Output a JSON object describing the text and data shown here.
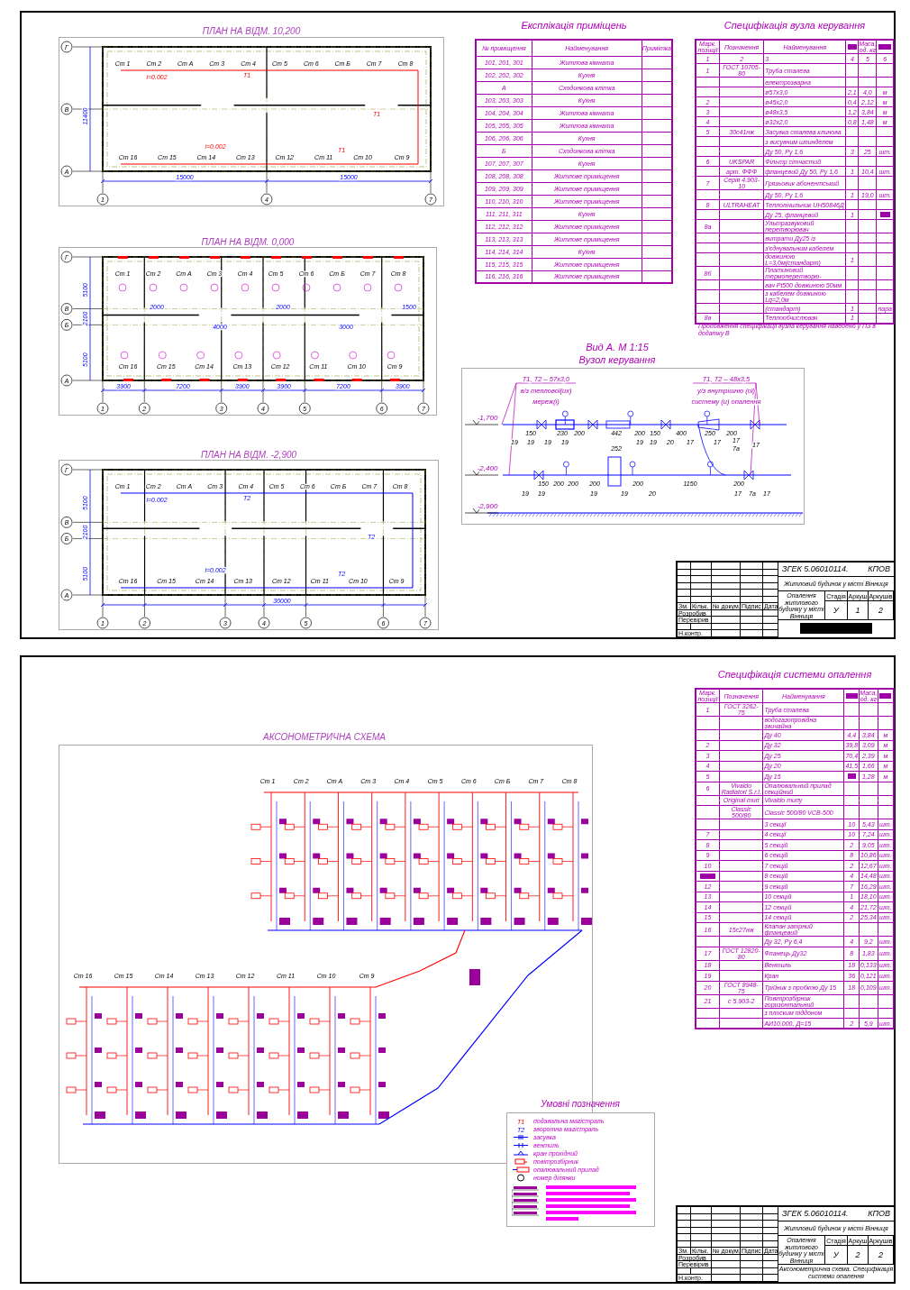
{
  "sheet_1": {
    "plans": [
      {
        "title": "ПЛАН НА ВІДМ. 10,200",
        "kind": "supply",
        "rows": [
          "Г",
          "В",
          "А"
        ],
        "cols": [
          "1",
          "4",
          "7"
        ],
        "dims": [
          "15000",
          "15000"
        ],
        "side_dims": [
          "11400"
        ],
        "top_risers": [
          "Ст 1",
          "Ст 2",
          "Ст А",
          "Ст 3",
          "Ст 4",
          "Ст 5",
          "Ст 6",
          "Ст Б",
          "Ст 7",
          "Ст 8"
        ],
        "bottom_risers": [
          "Ст 16",
          "Ст 15",
          "Ст 14",
          "Ст 13",
          "Ст 12",
          "Ст 11",
          "Ст 10",
          "Ст 9"
        ],
        "slopes": [
          "i=0.002",
          "i=0.002"
        ],
        "line_labels": [
          "Т1",
          "Т1",
          "Т1"
        ]
      },
      {
        "title": "ПЛАН НА ВІДМ. 0,000",
        "kind": "radiators",
        "rows": [
          "Г",
          "В",
          "Б",
          "А"
        ],
        "cols": [
          "1",
          "2",
          "3",
          "4",
          "5",
          "6",
          "7"
        ],
        "dims": [
          "3900",
          "7200",
          "3900",
          "3900",
          "7200",
          "3900"
        ],
        "side_dims": [
          "5100",
          "2100",
          "5100"
        ],
        "top_risers": [
          "Ст 1",
          "Ст 2",
          "Ст А",
          "Ст 3",
          "Ст 4",
          "Ст 5",
          "Ст 6",
          "Ст Б",
          "Ст 7",
          "Ст 8"
        ],
        "bottom_risers": [
          "Ст 16",
          "Ст 15",
          "Ст 14",
          "Ст 13",
          "Ст 12",
          "Ст 11",
          "Ст 10",
          "Ст 9"
        ],
        "inner_dims": [
          "2000",
          "4000",
          "2000",
          "3000",
          "1500"
        ]
      },
      {
        "title": "ПЛАН НА ВІДМ. -2,900",
        "kind": "return",
        "rows": [
          "Г",
          "В",
          "Б",
          "А"
        ],
        "cols": [
          "1",
          "2",
          "3",
          "4",
          "5",
          "6",
          "7"
        ],
        "dims": [
          "30000"
        ],
        "side_dims": [
          "5100",
          "2100",
          "5100"
        ],
        "top_risers": [
          "Ст 1",
          "Ст 2",
          "Ст А",
          "Ст 3",
          "Ст 4",
          "Ст 5",
          "Ст 6",
          "Ст Б",
          "Ст 7",
          "Ст 8"
        ],
        "bottom_risers": [
          "Ст 16",
          "Ст 15",
          "Ст 14",
          "Ст 13",
          "Ст 12",
          "Ст 11",
          "Ст 10",
          "Ст 9"
        ],
        "slopes": [
          "i=0.002",
          "i=0.002"
        ],
        "line_labels": [
          "Т2",
          "Т2",
          "Т2"
        ]
      }
    ],
    "explication": {
      "title": "Експлікація приміщень",
      "columns": [
        "№ приміщення",
        "Найменування",
        "Примітка"
      ],
      "rows": [
        [
          "101, 201, 301",
          "Житлова кімната",
          ""
        ],
        [
          "102, 202, 302",
          "Кухня",
          ""
        ],
        [
          "А",
          "Сходинкова клітка",
          ""
        ],
        [
          "103, 203, 303",
          "Кухня",
          ""
        ],
        [
          "104, 204, 304",
          "Житлова кімната",
          ""
        ],
        [
          "105, 205, 305",
          "Житлова кімната",
          ""
        ],
        [
          "106, 206, 306",
          "Кухня",
          ""
        ],
        [
          "Б",
          "Сходинкова клітка",
          ""
        ],
        [
          "107, 207, 307",
          "Кухня",
          ""
        ],
        [
          "108, 208, 308",
          "Житлове приміщення",
          ""
        ],
        [
          "109, 209, 309",
          "Житлове приміщення",
          ""
        ],
        [
          "110, 210, 310",
          "Житлове приміщення",
          ""
        ],
        [
          "111, 211, 311",
          "Кухня",
          ""
        ],
        [
          "112, 212, 312",
          "Житлове приміщення",
          ""
        ],
        [
          "113, 213, 313",
          "Житлове приміщення",
          ""
        ],
        [
          "114, 214, 314",
          "Кухня",
          ""
        ],
        [
          "115, 215, 315",
          "Житлове приміщення",
          ""
        ],
        [
          "116, 216, 316",
          "Житлове приміщення",
          ""
        ]
      ]
    },
    "spec": {
      "title": "Специфікація вузла керування",
      "columns": [
        "Марк. позиції",
        "Позначення",
        "Найменування",
        {
          "kind": "blot"
        },
        "Маса, од. кг",
        {
          "kind": "blot"
        }
      ],
      "rows": [
        [
          "1",
          "2",
          "3",
          "4",
          "5",
          "6"
        ],
        [
          "1",
          "ГОСТ 10705-80",
          "Труба сталева",
          "",
          "",
          ""
        ],
        [
          "",
          "",
          "електрозварна",
          "",
          "",
          ""
        ],
        [
          "",
          "",
          "ø57х3,0",
          "2,1",
          "4,0",
          "м"
        ],
        [
          "2",
          "",
          "ø45х2,0",
          "0,4",
          "2,12",
          "м"
        ],
        [
          "3",
          "",
          "ø48х3,5",
          "1,2",
          "3,84",
          "м"
        ],
        [
          "4",
          "",
          "ø32х2,0",
          "0,8",
          "1,48",
          "м"
        ],
        [
          "5",
          "30с41нж",
          "Засувка сталева клинова",
          "",
          "",
          ""
        ],
        [
          "",
          "",
          "з висувним шпинделем",
          "",
          "",
          ""
        ],
        [
          "",
          "",
          "Ду 50, Ру 1,6",
          "3",
          "25",
          "шт."
        ],
        [
          "6",
          "UKSPAR",
          "Фільтр сітчастий",
          "",
          "",
          ""
        ],
        [
          "",
          "арт. ФФФ",
          "фланцевий Ду 50, Ру 1,6",
          "1",
          "10,4",
          "шт."
        ],
        [
          "7",
          "Серія 4.903-10",
          "Грязьовик абонентський",
          "",
          "",
          ""
        ],
        [
          "",
          "",
          "Ду 50, Ру 1,6",
          "1",
          "19,0",
          "шт."
        ],
        [
          "8",
          "ULTRAHEAT",
          "Теплолічильник UH50846Д",
          "",
          "",
          ""
        ],
        [
          "",
          "",
          "Ду 25, фланцевий",
          "1",
          "",
          {
            "kind": "blot"
          }
        ],
        [
          "8а",
          "",
          "Ультразвуковий перетворювач",
          "",
          "",
          ""
        ],
        [
          "",
          "",
          "витрати Ду25 із",
          "",
          "",
          ""
        ],
        [
          "",
          "",
          "з'єднувальним кабелем",
          "",
          "",
          ""
        ],
        [
          "",
          "",
          "довжиною L=3,0м(стандарт)",
          "1",
          "",
          ""
        ],
        [
          "8б",
          "",
          "Платиновий термоперетворю-",
          "",
          "",
          ""
        ],
        [
          "",
          "",
          "вач Pt500 довжиною 50мм",
          "",
          "",
          ""
        ],
        [
          "",
          "",
          "з кабелем довжиною Lg=2,0м",
          "",
          "",
          ""
        ],
        [
          "",
          "",
          "(стандарт)",
          "1",
          "",
          "пара"
        ],
        [
          "8в",
          "",
          "Теплообчислювач",
          "1",
          "",
          ""
        ]
      ],
      "note": "Продовження специфікації вузла керування наведено у ПЗ в додатку В"
    },
    "valve_unit": {
      "title": "Вид А. М 1:15",
      "subtitle": "Вузол керування",
      "inlet": {
        "pipe": "Т1, Т2 – 57х3,0",
        "lines": [
          "в/з теплової(их)",
          "мереж(і)"
        ]
      },
      "outlet": {
        "pipe": "Т1, Т2 – 48х3,5",
        "lines": [
          "у/з внутрішню (ої)",
          "систему (и) опалення"
        ]
      },
      "levels": [
        "-1,700",
        "-2,400",
        "-2,900"
      ],
      "top_dims": [
        "150",
        "230",
        "200",
        "442",
        "200",
        "150",
        "400",
        "250",
        "200"
      ],
      "bottom_dims": [
        "150",
        "200",
        "200",
        "200",
        "252",
        "200",
        "1150",
        "200"
      ],
      "top_callouts": [
        "19",
        "19",
        "19",
        "19",
        "19",
        "19",
        "20",
        "17",
        "17",
        "17",
        "7а",
        "17"
      ],
      "bottom_callouts": [
        "19",
        "19",
        "19",
        "19",
        "20",
        "17",
        "7а",
        "17"
      ]
    },
    "title_block": {
      "code": "ЗГЕК 5.06010114.",
      "suffix": "КПОВ",
      "project": "Житловий будинок у місті Вінниця",
      "sheet_title": "Опалення житлового будинку у місті Вінниця",
      "col_headers": [
        "Зм.",
        "Кільк.",
        "№ докум.",
        "Підпис",
        "Дата"
      ],
      "roles": [
        "Розробив",
        "Перевірив",
        "Н.контр."
      ],
      "stage_headers": [
        "Стадія",
        "Аркуш",
        "Аркушів"
      ],
      "stage_values": [
        "У",
        "1",
        "2"
      ],
      "redacted": true
    }
  },
  "sheet_2": {
    "spec": {
      "title": "Специфікація системи опалення",
      "columns": [
        "Марк. позиції",
        "Позначення",
        "Найменування",
        {
          "kind": "blot"
        },
        "Маса, од. кг",
        {
          "kind": "blot"
        }
      ],
      "rows": [
        [
          "1",
          "ГОСТ 3262-75",
          "Труба сталева",
          "",
          "",
          ""
        ],
        [
          "",
          "",
          "водогазопровідна звичайна",
          "",
          "",
          ""
        ],
        [
          "",
          "",
          "Ду 40",
          "4,4",
          "3,84",
          "м"
        ],
        [
          "2",
          "",
          "Ду 32",
          "39,8",
          "3,09",
          "м"
        ],
        [
          "3",
          "",
          "Ду 25",
          "70,4",
          "2,39",
          "м"
        ],
        [
          "4",
          "",
          "Ду 20",
          "41,5",
          "1,66",
          "м"
        ],
        [
          "5",
          "",
          "Ду 15",
          {
            "kind": "blot"
          },
          "1,28",
          "м"
        ],
        [
          "6",
          "Vivaldo Radiatori S.r.l.",
          "Опалювальний прилад секційний",
          "",
          "",
          ""
        ],
        [
          "",
          "Original тип",
          "Vivaldo типу",
          "",
          "",
          ""
        ],
        [
          "",
          "Classic 500/80",
          "Classic 500/80 VCB-500",
          "",
          "",
          ""
        ],
        [
          "",
          "",
          "3 секції",
          "10",
          "5,43",
          "шт."
        ],
        [
          "7",
          "",
          "4 секції",
          "10",
          "7,24",
          "шт."
        ],
        [
          "8",
          "",
          "5 секцій",
          "2",
          "9,05",
          "шт."
        ],
        [
          "9",
          "",
          "6 секцій",
          "8",
          "10,86",
          "шт."
        ],
        [
          "10",
          "",
          "7 секцій",
          "2",
          "12,67",
          "шт."
        ],
        [
          {
            "kind": "blot"
          },
          "",
          "8 секцій",
          "4",
          "14,48",
          "шт."
        ],
        [
          "12",
          "",
          "9 секцій",
          "7",
          "16,29",
          "шт."
        ],
        [
          "13",
          "",
          "10 секцій",
          "1",
          "18,10",
          "шт."
        ],
        [
          "14",
          "",
          "12 секцій",
          "4",
          "21,72",
          "шт."
        ],
        [
          "15",
          "",
          "14 секцій",
          "2",
          "25,34",
          "шт."
        ],
        [
          "16",
          "15с27нж",
          "Клапан запірний фланцевий",
          "",
          "",
          ""
        ],
        [
          "",
          "",
          "Ду 32, Ру 6,4",
          "4",
          "9,2",
          "шт."
        ],
        [
          "17",
          "ГОСТ 12820-80",
          "Фланець Ду32",
          "8",
          "1,83",
          "шт."
        ],
        [
          "18",
          "",
          "Вентиль",
          "18",
          "0,133",
          "шт."
        ],
        [
          "19",
          "",
          "Кран",
          "36",
          "0,121",
          "шт."
        ],
        [
          "20",
          "ГОСТ 8948-75",
          "Трійник з пробкою Ду 15",
          "18",
          "0,109",
          "шт."
        ],
        [
          "21",
          "с 5.903-2",
          "Повітрозбірник горизонтальний",
          "",
          "",
          ""
        ],
        [
          "",
          "",
          "з плоским піддоном",
          "",
          "",
          ""
        ],
        [
          "",
          "",
          "АИ10.000, Д=15",
          "2",
          "5,9",
          "шт."
        ]
      ]
    },
    "axonometric": {
      "title": "АКСОНОМЕТРИЧНА СХЕМА",
      "upper_risers": [
        "Ст 1",
        "Ст 2",
        "Ст А",
        "Ст 3",
        "Ст 4",
        "Ст 5",
        "Ст 6",
        "Ст Б",
        "Ст 7",
        "Ст 8"
      ],
      "lower_risers": [
        "Ст 16",
        "Ст 15",
        "Ст 14",
        "Ст 13",
        "Ст 12",
        "Ст 11",
        "Ст 10",
        "Ст 9"
      ]
    },
    "legend": {
      "title": "Умовні позначення",
      "items": [
        {
          "kind": "supply",
          "symbol": "Т1",
          "label": "подавальна магістраль"
        },
        {
          "kind": "return",
          "symbol": "Т2",
          "label": "зворотна магістраль"
        },
        {
          "kind": "gate-valve",
          "label": "засувка"
        },
        {
          "kind": "valve",
          "label": "вентиль"
        },
        {
          "kind": "plug-valve",
          "label": "кран прохідний"
        },
        {
          "kind": "air-vent",
          "label": "повітрозбірник"
        },
        {
          "kind": "radiator",
          "label": "опалювальний прилад"
        },
        {
          "kind": "section",
          "label": "номер ділянки"
        }
      ]
    },
    "title_block": {
      "code": "ЗГЕК 5.06010114.",
      "suffix": "КПОВ",
      "project": "Житловий будинок у місті Вінниця",
      "sheet_title": "Опалення житлового будинку у місті Вінниця",
      "col_headers": [
        "Зм.",
        "Кільк.",
        "№ докум.",
        "Підпис",
        "Дата"
      ],
      "roles": [
        "Розробив",
        "Перевірив",
        "Н.контр."
      ],
      "stage_headers": [
        "Стадія",
        "Аркуш",
        "Аркушів"
      ],
      "stage_values": [
        "У",
        "2",
        "2"
      ],
      "redacted": false,
      "drawing_name": "Аксонометрична схема. Специфікація системи опалення"
    }
  }
}
